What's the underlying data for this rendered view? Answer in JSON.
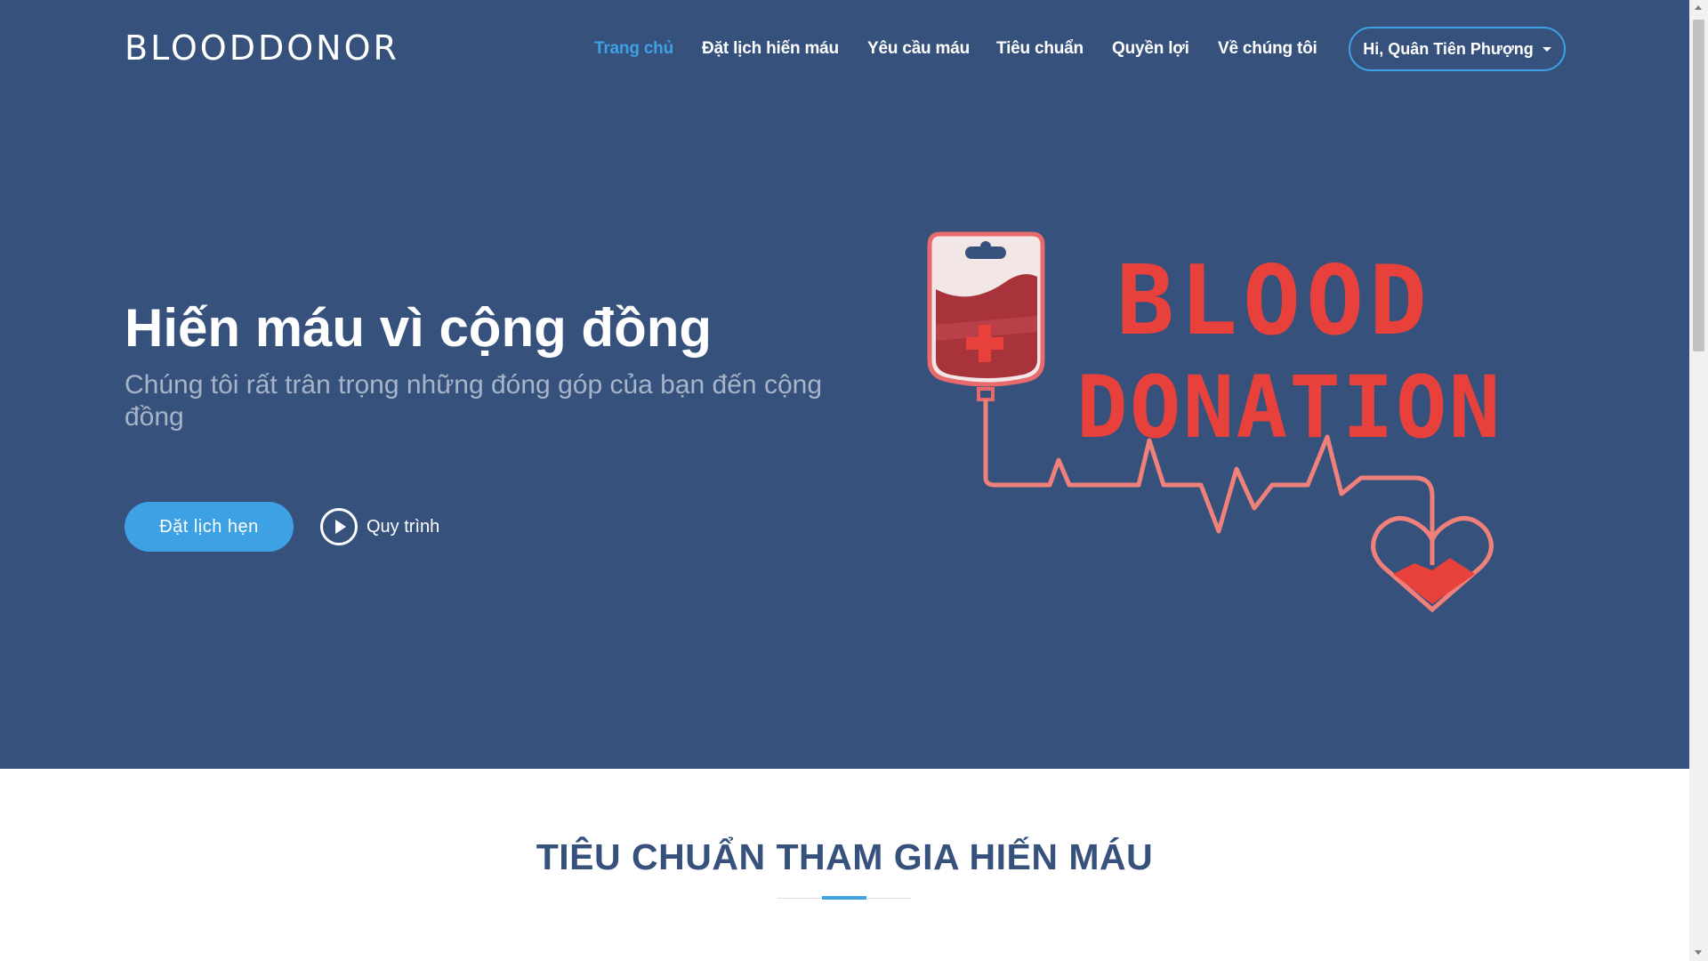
{
  "brand": {
    "name": "BLOODDONOR"
  },
  "nav": {
    "items": [
      {
        "label": "Trang chủ",
        "active": true
      },
      {
        "label": "Đặt lịch hiến máu",
        "active": false
      },
      {
        "label": "Yêu cầu máu",
        "active": false
      },
      {
        "label": "Tiêu chuẩn",
        "active": false
      },
      {
        "label": "Quyền lợi",
        "active": false
      },
      {
        "label": "Về chúng tôi",
        "active": false
      }
    ],
    "user_menu": "Hi, Quân Tiên Phượng"
  },
  "hero": {
    "title": "Hiến máu vì cộng đồng",
    "subtitle": "Chúng tôi rất trân trọng những đóng góp của bạn đến cộng đồng",
    "cta_label": "Đặt lịch hẹn",
    "process_label": "Quy trình",
    "illustration": {
      "line1": "BLOOD",
      "line2": "DONATION"
    }
  },
  "section": {
    "title": "TIÊU CHUẨN THAM GIA HIẾN MÁU"
  },
  "colors": {
    "hero_bg": "#36517c",
    "accent": "#3ea1e4",
    "blood_red": "#e8413c",
    "section_title": "#36517c"
  }
}
